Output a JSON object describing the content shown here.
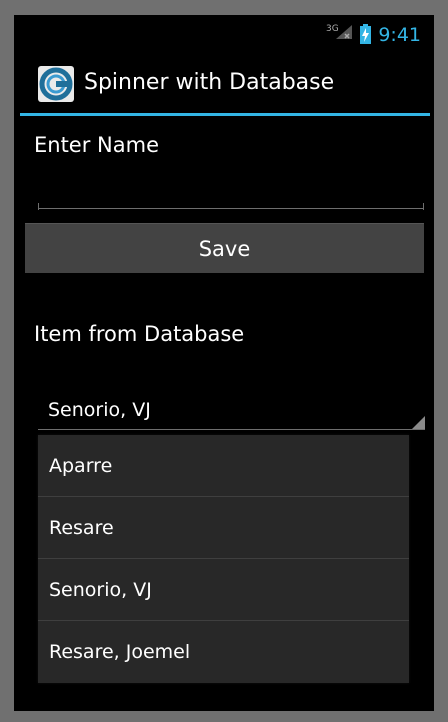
{
  "status_bar": {
    "network": "3G",
    "time": "9:41",
    "accent_color": "#33b5e5"
  },
  "action_bar": {
    "icon": "app-logo-icon",
    "title": "Spinner with Database"
  },
  "form": {
    "name_label": "Enter Name",
    "name_value": "",
    "save_label": "Save",
    "db_label": "Item from Database"
  },
  "spinner": {
    "selected": "Senorio, VJ",
    "options": [
      "Aparre",
      "Resare",
      "Senorio, VJ",
      "Resare, Joemel"
    ]
  }
}
